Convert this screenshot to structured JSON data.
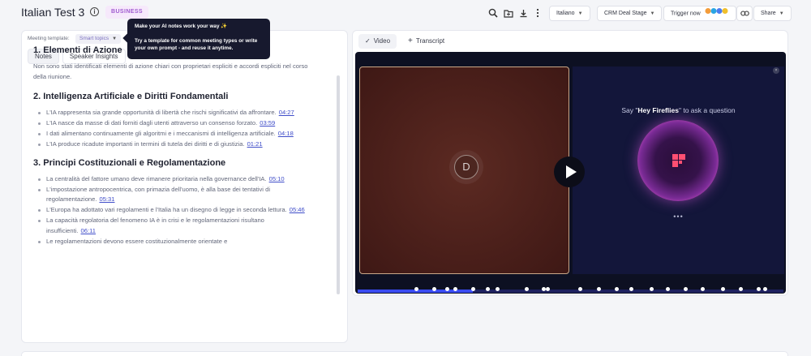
{
  "header": {
    "title": "Italian Test 3",
    "badge": "BUSINESS",
    "language": "Italiano",
    "crm_stage": "CRM Deal Stage",
    "trigger": "Trigger now",
    "share": "Share"
  },
  "tooltip": {
    "title": "Make your AI notes work your way ✨",
    "body": "Try a template for common meeting types or write your own prompt - and reuse it anytime."
  },
  "left": {
    "meeting_template_label": "Meeting template:",
    "meeting_template_value": "Smart topics",
    "tabs": [
      "Notes",
      "Speaker Insights"
    ]
  },
  "notes": {
    "s1_title": "1. Elementi di Azione",
    "s1_text": "Non sono stati identificati elementi di azione chiari con proprietari espliciti e accordi espliciti nel corso della riunione.",
    "s2_title": "2. Intelligenza Artificiale e Diritti Fondamentali",
    "s2_items": [
      {
        "text": "L'IA rappresenta sia grande opportunità di libertà che rischi significativi da affrontare.",
        "ts": "04:27"
      },
      {
        "text": "L'IA nasce da masse di dati forniti dagli utenti attraverso un consenso forzato.",
        "ts": "03:59"
      },
      {
        "text": "I dati alimentano continuamente gli algoritmi e i meccanismi di intelligenza artificiale.",
        "ts": "04:18"
      },
      {
        "text": "L'IA produce ricadute importanti in termini di tutela dei diritti e di giustizia.",
        "ts": "01:21"
      }
    ],
    "s3_title": "3. Principi Costituzionali e Regolamentazione",
    "s3_items": [
      {
        "text": "La centralità del fattore umano deve rimanere prioritaria nella governance dell'IA.",
        "ts": "05:10"
      },
      {
        "text": "L'impostazione antropocentrica, con primazia dell'uomo, è alla base dei tentativi di regolamentazione.",
        "ts": "05:31"
      },
      {
        "text": "L'Europa ha adottato vari regolamenti e l'Italia ha un disegno di legge in seconda lettura.",
        "ts": "05:46"
      },
      {
        "text": "La capacità regolatoria del fenomeno IA è in crisi e le regolamentazioni risultano insufficienti.",
        "ts": "06:11"
      },
      {
        "text": "Le regolamentazioni devono essere costituzionalmente orientate e",
        "ts": ""
      }
    ]
  },
  "right": {
    "tab_video": "Video",
    "tab_transcript": "Transcript",
    "avatar_letter": "D",
    "fire_prefix": "Say \"",
    "fire_bold": "Hey Fireflies",
    "fire_suffix": "\" to ask a question",
    "progress_fraction": 0.27
  },
  "colors": {
    "accent": "#3f4dc9",
    "badge_text": "#a05bd0",
    "tooltip_bg": "#17192e"
  }
}
